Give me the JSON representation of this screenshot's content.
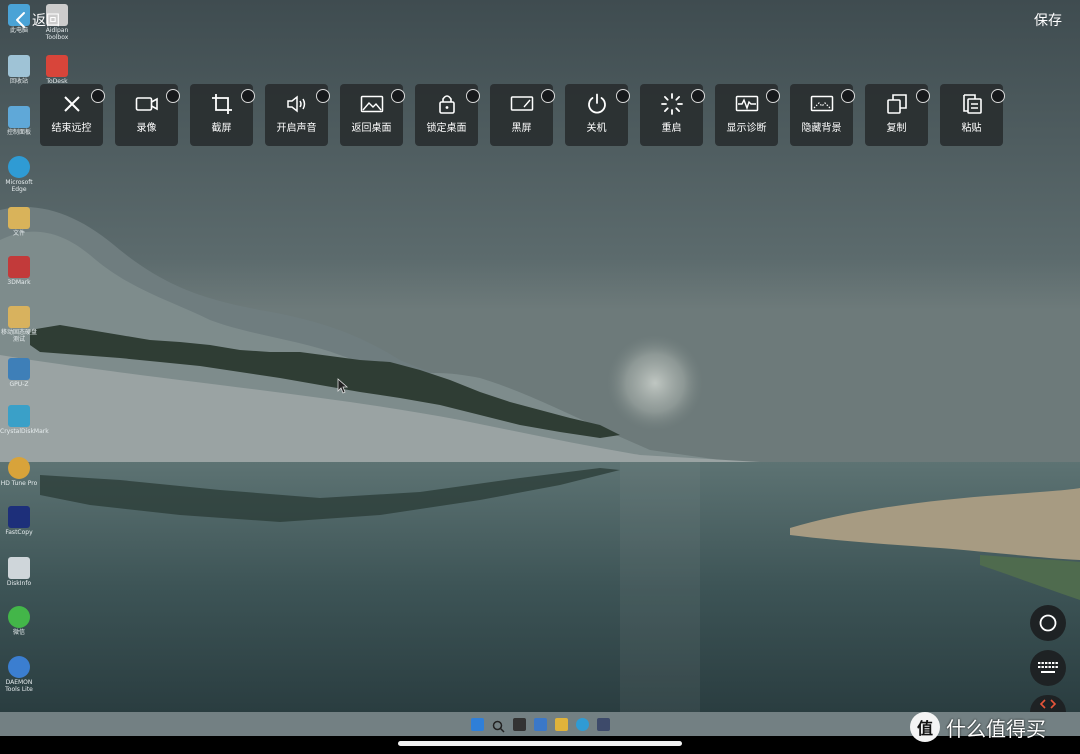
{
  "header": {
    "back_label": "返回",
    "save_label": "保存"
  },
  "toolbar": {
    "items": [
      {
        "label": "结束远控",
        "icon": "close-icon"
      },
      {
        "label": "录像",
        "icon": "video-camera-icon"
      },
      {
        "label": "截屏",
        "icon": "crop-icon"
      },
      {
        "label": "开启声音",
        "icon": "speaker-icon"
      },
      {
        "label": "返回桌面",
        "icon": "picture-icon"
      },
      {
        "label": "锁定桌面",
        "icon": "lock-icon"
      },
      {
        "label": "黑屏",
        "icon": "black-screen-icon"
      },
      {
        "label": "关机",
        "icon": "power-icon"
      },
      {
        "label": "重启",
        "icon": "loading-spinner-icon"
      },
      {
        "label": "显示诊断",
        "icon": "diagnostics-pulse-icon"
      },
      {
        "label": "隐藏背景",
        "icon": "hide-background-icon"
      },
      {
        "label": "复制",
        "icon": "copy-icon"
      },
      {
        "label": "粘贴",
        "icon": "paste-icon"
      }
    ]
  },
  "floating_buttons": [
    {
      "name": "home-circle-button",
      "icon": "circle-icon"
    },
    {
      "name": "keyboard-button",
      "icon": "keyboard-icon"
    },
    {
      "name": "collapse-button",
      "icon": "chevrons-icon"
    }
  ],
  "desktop": {
    "icons": [
      {
        "label": "此电脑",
        "color": "#4aa3d6"
      },
      {
        "label": "回收站",
        "color": "#9fc3d6"
      },
      {
        "label": "控制面板",
        "color": "#5fa8d8"
      },
      {
        "label": "Microsoft Edge",
        "color": "#2f9bd4"
      },
      {
        "label": "文件",
        "color": "#d9b35a"
      },
      {
        "label": "3DMark",
        "color": "#c23a3a"
      },
      {
        "label": "移动固态硬盘测试",
        "color": "#d8b25e"
      },
      {
        "label": "GPU-Z",
        "color": "#3e7fb8"
      },
      {
        "label": "CrystalDiskMark",
        "color": "#3aa0c8"
      },
      {
        "label": "HD Tune Pro",
        "color": "#d8a33a"
      },
      {
        "label": "FastCopy",
        "color": "#1d2f7a"
      },
      {
        "label": "DiskInfo",
        "color": "#cfd6da"
      },
      {
        "label": "微信",
        "color": "#43b649"
      },
      {
        "label": "DAEMON Tools Lite",
        "color": "#3b7ed0"
      }
    ],
    "second_column": [
      {
        "label": "Aidlpan Toolbox",
        "color": "#cccccc"
      },
      {
        "label": "ToDesk",
        "color": "#d8453a"
      }
    ]
  },
  "watermark": {
    "text": "什么值得买",
    "logo_char": "值"
  }
}
